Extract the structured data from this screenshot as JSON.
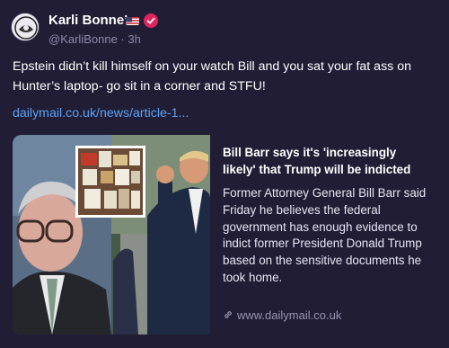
{
  "post": {
    "author": {
      "name": "Karli Bonne’",
      "handle": "@KarliBonne",
      "separator": "·",
      "time": "3h",
      "flag": "us-flag-icon",
      "badge": "verified-icon"
    },
    "text": "Epstein didn’t kill himself on your watch Bill and you sat your fat ass on Hunter’s laptop- go sit in a corner and STFU!",
    "link": "dailymail.co.uk/news/article-1...",
    "card": {
      "title": "Bill Barr says it's 'increasingly likely' that Trump will be indicted",
      "description": "Former Attorney General Bill Barr said Friday he believes the federal government has enough evidence to indict former President Donald Trump based on the sensitive documents he took home.",
      "domain": "www.dailymail.co.uk",
      "image": "news-photo"
    }
  },
  "colors": {
    "background": "#201d35",
    "link": "#5ba3f5",
    "muted": "#8f8aa8",
    "verified": "#e0245e"
  }
}
